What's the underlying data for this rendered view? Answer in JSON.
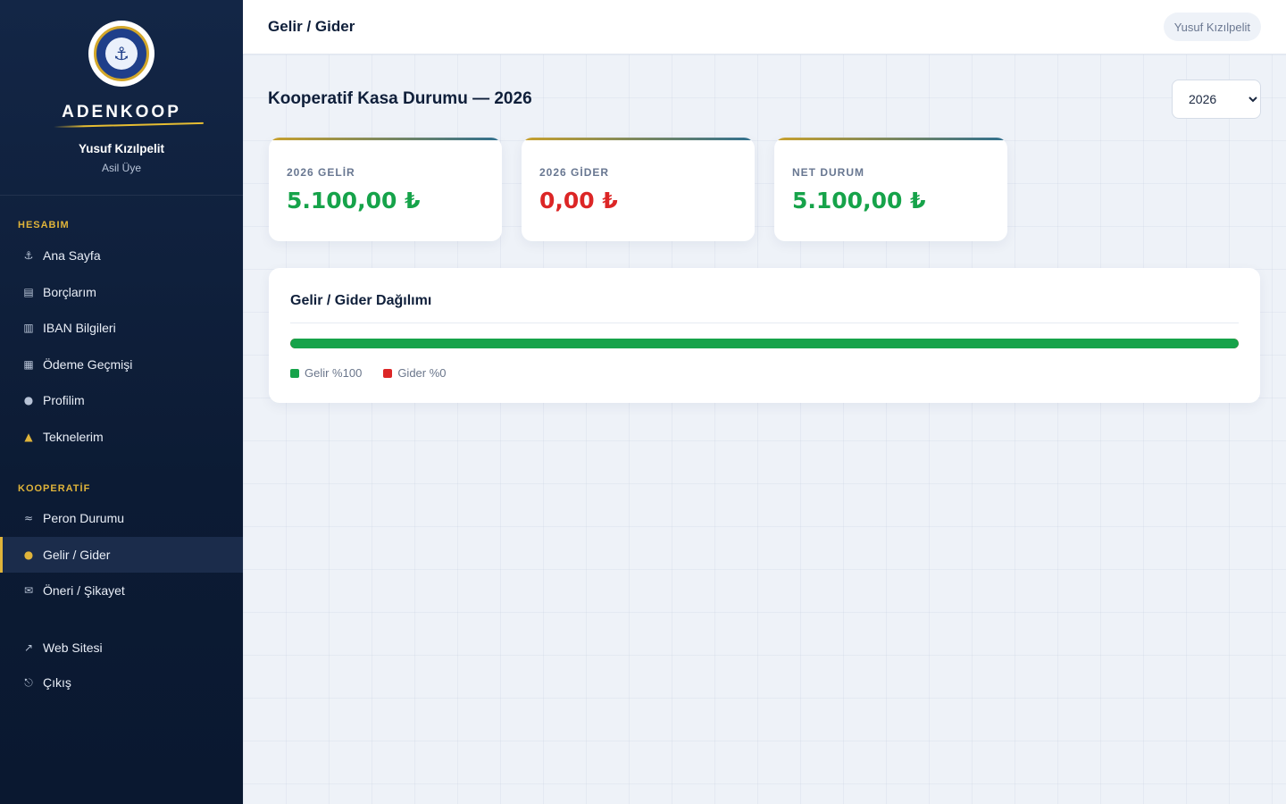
{
  "sidebar": {
    "brand": "ADENKOOP",
    "user_name": "Yusuf Kızılpelit",
    "user_role": "Asil Üye",
    "sections": [
      {
        "title": "HESABIM",
        "items": [
          {
            "icon": "anchor-icon",
            "glyph": "⚓",
            "label": "Ana Sayfa"
          },
          {
            "icon": "clipboard-icon",
            "glyph": "▤",
            "label": "Borçlarım"
          },
          {
            "icon": "bank-icon",
            "glyph": "▥",
            "label": "IBAN Bilgileri"
          },
          {
            "icon": "receipt-icon",
            "glyph": "▦",
            "label": "Ödeme Geçmişi"
          },
          {
            "icon": "user-icon",
            "glyph": "●",
            "label": "Profilim"
          },
          {
            "icon": "boat-icon",
            "glyph": "▲",
            "label": "Teknelerim"
          }
        ]
      },
      {
        "title": "KOOPERATİF",
        "items": [
          {
            "icon": "map-icon",
            "glyph": "≈",
            "label": "Peron Durumu"
          },
          {
            "icon": "money-bag-icon",
            "glyph": "●",
            "label": "Gelir / Gider",
            "active": true
          },
          {
            "icon": "envelope-icon",
            "glyph": "✉",
            "label": "Öneri / Şikayet"
          }
        ]
      },
      {
        "title": "",
        "items": [
          {
            "icon": "external-link-icon",
            "glyph": "↗",
            "label": "Web Sitesi"
          },
          {
            "icon": "logout-icon",
            "glyph": "⎋",
            "label": "Çıkış"
          }
        ]
      }
    ]
  },
  "topbar": {
    "title": "Gelir / Gider",
    "user_chip": "Yusuf Kızılpelit"
  },
  "main": {
    "title": "Kooperatif Kasa Durumu — 2026",
    "year_select": {
      "selected": "2026",
      "options": [
        "2026"
      ]
    },
    "stats": [
      {
        "label": "2026 GELİR",
        "value": "5.100,00 ₺",
        "tone": "green"
      },
      {
        "label": "2026 GİDER",
        "value": "0,00 ₺",
        "tone": "red"
      },
      {
        "label": "NET DURUM",
        "value": "5.100,00 ₺",
        "tone": "green"
      }
    ],
    "distribution": {
      "title": "Gelir / Gider Dağılımı",
      "income_share": 1.0,
      "legend_income": "Gelir %100",
      "legend_expense": "Gider %0"
    }
  },
  "colors": {
    "income": "#16a34a",
    "expense": "#dc2626",
    "accent_gold": "#e0b43a",
    "sidebar_bg": "#0c1b34"
  }
}
